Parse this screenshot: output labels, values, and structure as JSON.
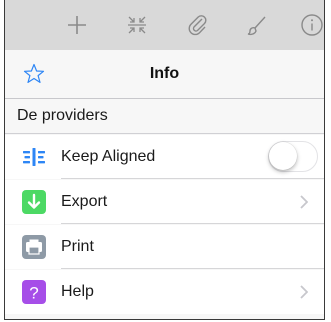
{
  "toolbar": {
    "icons": [
      "plus-icon",
      "collapse-icon",
      "paperclip-icon",
      "brush-icon",
      "info-icon"
    ]
  },
  "header": {
    "title": "Info",
    "favorite_icon": "star-icon"
  },
  "section": {
    "label": "De providers"
  },
  "rows": [
    {
      "label": "Keep Aligned",
      "icon": "keep-aligned-icon",
      "control": "toggle",
      "toggle_on": false
    },
    {
      "label": "Export",
      "icon": "export-icon",
      "control": "chevron"
    },
    {
      "label": "Print",
      "icon": "print-icon",
      "control": "none"
    },
    {
      "label": "Help",
      "icon": "help-icon",
      "control": "chevron"
    }
  ],
  "colors": {
    "accent": "#2e86f5",
    "export_green": "#4cd964",
    "help_purple": "#a64ee8",
    "print_gray": "#8e9aa6",
    "toolbar_bg": "#d9d9d9"
  }
}
